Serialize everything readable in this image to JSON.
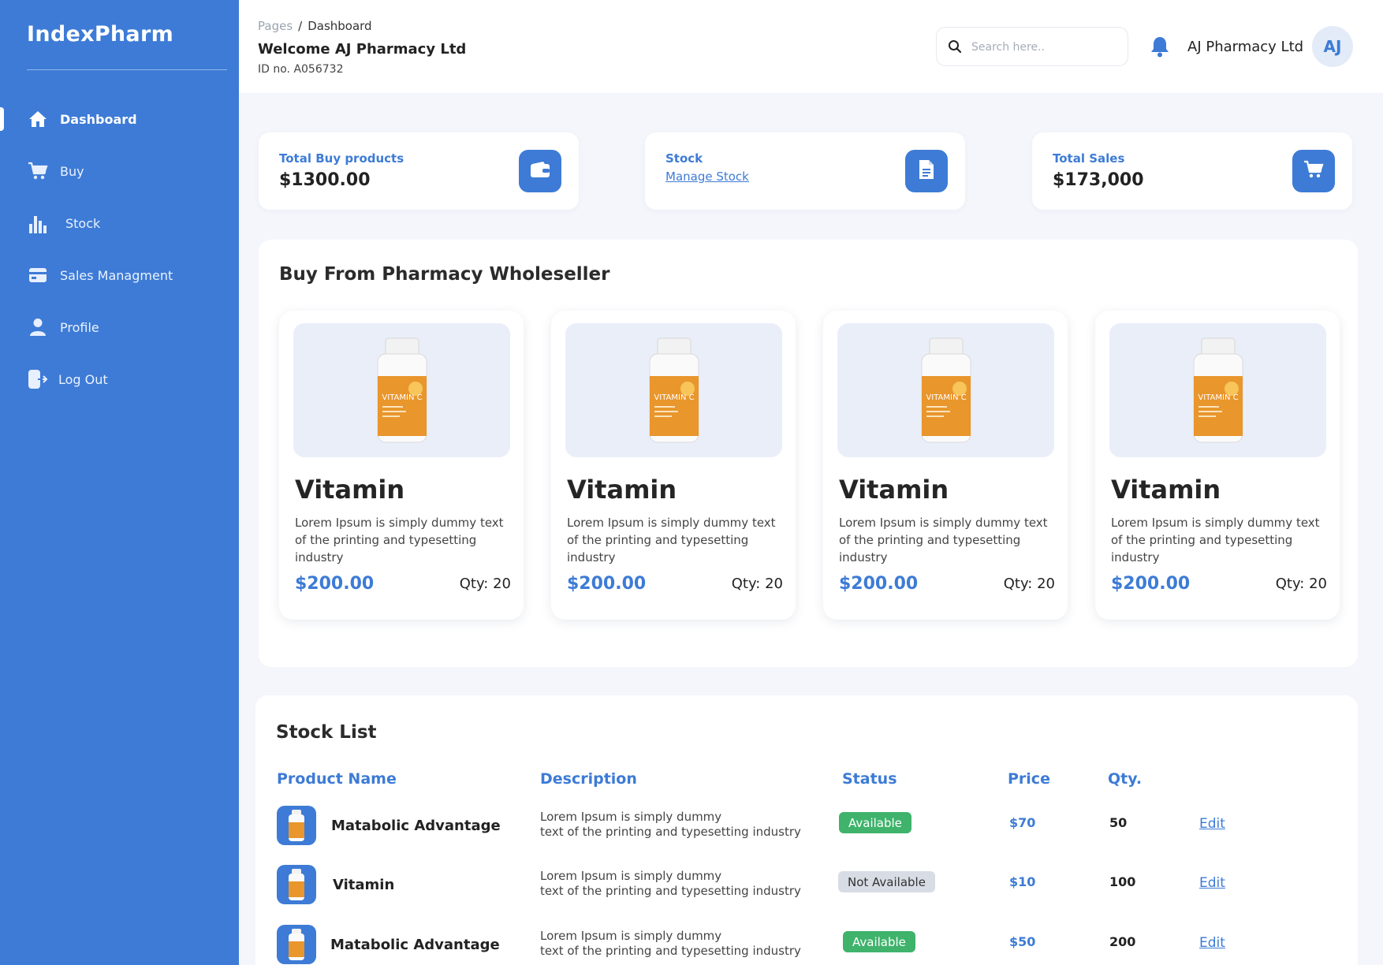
{
  "app": {
    "name": "IndexPharm"
  },
  "sidebar": {
    "items": [
      {
        "label": "Dashboard",
        "icon": "home-icon",
        "active": true
      },
      {
        "label": "Buy",
        "icon": "cart-icon",
        "active": false
      },
      {
        "label": "Stock",
        "icon": "bar-chart-icon",
        "active": false
      },
      {
        "label": "Sales Managment",
        "icon": "card-icon",
        "active": false
      },
      {
        "label": "Profile",
        "icon": "user-icon",
        "active": false
      },
      {
        "label": "Log Out",
        "icon": "logout-icon",
        "active": false
      }
    ]
  },
  "header": {
    "breadcrumb": {
      "parent": "Pages",
      "separator": "/",
      "current": "Dashboard"
    },
    "welcome": "Welcome AJ Pharmacy Ltd",
    "id_text": "ID no. A056732",
    "search_placeholder": "Search here..",
    "user_name": "AJ Pharmacy Ltd",
    "avatar_initials": "AJ"
  },
  "stats": {
    "buy": {
      "label": "Total Buy products",
      "value": "$1300.00",
      "icon": "wallet-icon"
    },
    "stock": {
      "label": "Stock",
      "link": "Manage Stock",
      "icon": "document-icon"
    },
    "sales": {
      "label": "Total Sales",
      "value": "$173,000",
      "icon": "cart-icon"
    }
  },
  "wholesale": {
    "title": "Buy From Pharmacy Wholeseller",
    "products": [
      {
        "name": "Vitamin",
        "description": "Lorem Ipsum is simply dummy text of the printing and typesetting industry",
        "price": "$200.00",
        "qty": "Qty: 20",
        "label": "VITAMIN C"
      },
      {
        "name": "Vitamin",
        "description": "Lorem Ipsum is simply dummy text of the printing and typesetting industry",
        "price": "$200.00",
        "qty": "Qty: 20",
        "label": "VITAMIN C"
      },
      {
        "name": "Vitamin",
        "description": "Lorem Ipsum is simply dummy text of the printing and typesetting industry",
        "price": "$200.00",
        "qty": "Qty: 20",
        "label": "VITAMIN C"
      },
      {
        "name": "Vitamin",
        "description": "Lorem Ipsum is simply dummy text of the printing and typesetting industry",
        "price": "$200.00",
        "qty": "Qty: 20",
        "label": "VITAMIN C"
      }
    ]
  },
  "stock_list": {
    "title": "Stock List",
    "columns": [
      "Product Name",
      "Description",
      "Status",
      "Price",
      "Qty."
    ],
    "rows": [
      {
        "name": "Matabolic Advantage",
        "desc_line1": "Lorem Ipsum is simply dummy",
        "desc_line2": "text of the printing and typesetting industry",
        "status": "Available",
        "price": "$70",
        "qty": "50",
        "action": "Edit"
      },
      {
        "name": "Vitamin",
        "desc_line1": "Lorem Ipsum is simply dummy",
        "desc_line2": "text of the printing and typesetting industry",
        "status": "Not Available",
        "price": "$10",
        "qty": "100",
        "action": "Edit"
      },
      {
        "name": "Matabolic Advantage",
        "desc_line1": "Lorem Ipsum is simply dummy",
        "desc_line2": "text of the printing and typesetting industry",
        "status": "Available",
        "price": "$50",
        "qty": "200",
        "action": "Edit"
      }
    ]
  },
  "colors": {
    "accent": "#3d7bd6",
    "available": "#3fb36b",
    "not_available": "#d8dde5",
    "background": "#f4f6fb"
  }
}
